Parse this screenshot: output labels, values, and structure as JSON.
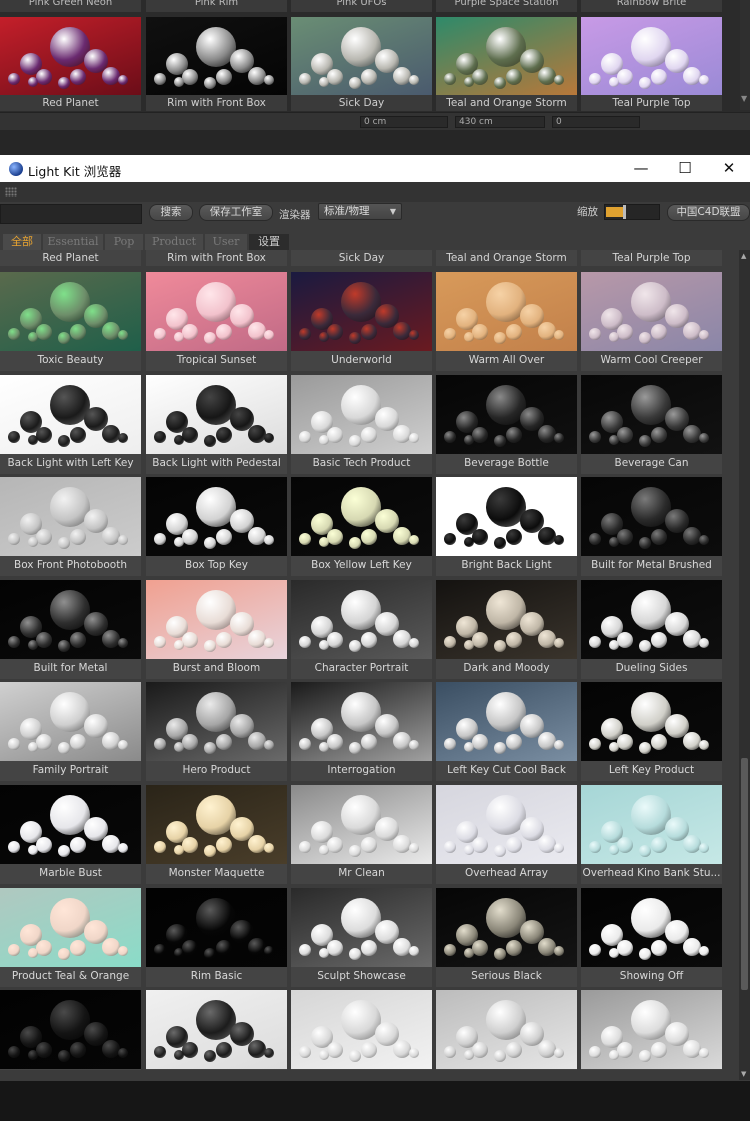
{
  "background_app": {
    "prev_row_labels": [
      "Pink Green Neon",
      "Pink Rim",
      "Pink UFOs",
      "Purple Space Station",
      "Rainbow Brite"
    ],
    "tiles": [
      {
        "label": "Red Planet",
        "bg": [
          "#c41f2a",
          "#6b0d18"
        ],
        "sphere": "#6a2a70"
      },
      {
        "label": "Rim with Front Box",
        "bg": [
          "#101010",
          "#040404"
        ],
        "sphere": "#8a8a8a"
      },
      {
        "label": "Sick Day",
        "bg": [
          "#6a8e74",
          "#4a5a6e"
        ],
        "sphere": "#b8b7b0"
      },
      {
        "label": "Teal and Orange Storm",
        "bg": [
          "#2e8a6a",
          "#b8783a"
        ],
        "sphere": "#5e6e4e"
      },
      {
        "label": "Teal Purple Top",
        "bg": [
          "#c89ae6",
          "#9a8ad6"
        ],
        "sphere": "#e0d6f0"
      }
    ],
    "fields": [
      "0 cm",
      "430 cm",
      "0"
    ]
  },
  "window": {
    "title": "Light Kit 浏览器",
    "controls": {
      "minimize": "—",
      "maximize": "☐",
      "close": "✕"
    }
  },
  "toolbar": {
    "search_value": "",
    "search_button": "搜索",
    "save_button": "保存工作室",
    "renderer_label": "渲染器",
    "renderer_value": "标准/物理",
    "zoom_label": "缩放",
    "zoom_value": 0.35,
    "union_button": "中国C4D联盟"
  },
  "tabs": [
    {
      "label": "全部",
      "active": true
    },
    {
      "label": "Essential",
      "active": false
    },
    {
      "label": "Pop",
      "active": false
    },
    {
      "label": "Product",
      "active": false
    },
    {
      "label": "User",
      "active": false
    },
    {
      "label": "设置",
      "active": false,
      "plain": true
    }
  ],
  "grid": {
    "header_row": [
      "Red Planet",
      "Rim with Front Box",
      "Sick Day",
      "Teal and Orange Storm",
      "Teal Purple Top"
    ],
    "items": [
      {
        "label": "Toxic Beauty",
        "bg": [
          "#5a6a4c",
          "#1f5f4a"
        ],
        "sphere": "#6e8e6a",
        "hl": "#7fe08a"
      },
      {
        "label": "Tropical Sunset",
        "bg": [
          "#f08a9a",
          "#c06a86"
        ],
        "sphere": "#f2c2cc",
        "hl": "#ffe6ea"
      },
      {
        "label": "Underworld",
        "bg": [
          "#1a1a40",
          "#6a1a20"
        ],
        "sphere": "#3a2a3a",
        "hl": "#c03a2a"
      },
      {
        "label": "Warm All Over",
        "bg": [
          "#d89a5a",
          "#c2804a"
        ],
        "sphere": "#e2b27e",
        "hl": "#f6d2a6"
      },
      {
        "label": "Warm Cool Creeper",
        "bg": [
          "#b898a8",
          "#8a86a8"
        ],
        "sphere": "#cdbcc8",
        "hl": "#f0e6ea"
      },
      {
        "label": "Back Light with Left Key",
        "bg": [
          "#ffffff",
          "#eeeeee"
        ],
        "sphere": "#1a1a1a",
        "hl": "#555555"
      },
      {
        "label": "Back Light with Pedestal",
        "bg": [
          "#ffffff",
          "#dcdcdc"
        ],
        "sphere": "#161616",
        "hl": "#444444"
      },
      {
        "label": "Basic Tech Product",
        "bg": [
          "#9a9a9a",
          "#cfcfcf"
        ],
        "sphere": "#d8d8d8",
        "hl": "#ffffff"
      },
      {
        "label": "Beverage Bottle",
        "bg": [
          "#060606",
          "#101010"
        ],
        "sphere": "#262626",
        "hl": "#8a8a8a"
      },
      {
        "label": "Beverage Can",
        "bg": [
          "#080808",
          "#121212"
        ],
        "sphere": "#3a3a3a",
        "hl": "#9a9a9a"
      },
      {
        "label": "Box Front Photobooth",
        "bg": [
          "#b6b6b6",
          "#cccccc"
        ],
        "sphere": "#c4c4c4",
        "hl": "#f2f2f2"
      },
      {
        "label": "Box Top Key",
        "bg": [
          "#040404",
          "#0a0a0a"
        ],
        "sphere": "#d2d2d2",
        "hl": "#ffffff"
      },
      {
        "label": "Box Yellow Left Key",
        "bg": [
          "#050505",
          "#0c0c0c"
        ],
        "sphere": "#d6d8b2",
        "hl": "#fbffd6"
      },
      {
        "label": "Bright Back Light",
        "bg": [
          "#ffffff",
          "#ffffff"
        ],
        "sphere": "#0c0c0c",
        "hl": "#3a3a3a"
      },
      {
        "label": "Built for Metal Brushed",
        "bg": [
          "#060606",
          "#0c0c0c"
        ],
        "sphere": "#2a2a2a",
        "hl": "#7a7a7a"
      },
      {
        "label": "Built for Metal",
        "bg": [
          "#030303",
          "#0a0a0a"
        ],
        "sphere": "#2e2e2e",
        "hl": "#909090"
      },
      {
        "label": "Burst and Bloom",
        "bg": [
          "#f0a090",
          "#e8d4dc"
        ],
        "sphere": "#e8dcd6",
        "hl": "#ffffff"
      },
      {
        "label": "Character Portrait",
        "bg": [
          "#2a2a2a",
          "#5a5a5a"
        ],
        "sphere": "#d4d4d4",
        "hl": "#ffffff"
      },
      {
        "label": "Dark and Moody",
        "bg": [
          "#141210",
          "#3a342c"
        ],
        "sphere": "#bfb6a6",
        "hl": "#efe6d6"
      },
      {
        "label": "Dueling Sides",
        "bg": [
          "#060606",
          "#0e0e0e"
        ],
        "sphere": "#d6d6d6",
        "hl": "#ffffff"
      },
      {
        "label": "Family Portrait",
        "bg": [
          "#d0d0d0",
          "#8a8a8a"
        ],
        "sphere": "#cfcfcf",
        "hl": "#ffffff"
      },
      {
        "label": "Hero Product",
        "bg": [
          "#1a1a1a",
          "#6a6a6a"
        ],
        "sphere": "#a6a6a6",
        "hl": "#eaeaea"
      },
      {
        "label": "Interrogation",
        "bg": [
          "#1a1a1a",
          "#a0a0a0"
        ],
        "sphere": "#c6c6c6",
        "hl": "#ffffff"
      },
      {
        "label": "Left Key Cut Cool Back",
        "bg": [
          "#3a4e62",
          "#7a8ea2"
        ],
        "sphere": "#c6c6c6",
        "hl": "#ffffff"
      },
      {
        "label": "Left Key Product",
        "bg": [
          "#040404",
          "#0a0a0a"
        ],
        "sphere": "#d0cfc8",
        "hl": "#ffffff"
      },
      {
        "label": "Marble Bust",
        "bg": [
          "#030303",
          "#080808"
        ],
        "sphere": "#e6e6ea",
        "hl": "#ffffff"
      },
      {
        "label": "Monster Maquette",
        "bg": [
          "#2a2418",
          "#4a3e2a"
        ],
        "sphere": "#e6d2a6",
        "hl": "#fff2d0"
      },
      {
        "label": "Mr Clean",
        "bg": [
          "#8a8a8a",
          "#eaeaea"
        ],
        "sphere": "#dadada",
        "hl": "#ffffff"
      },
      {
        "label": "Overhead Array",
        "bg": [
          "#d6d6de",
          "#eaeaf0"
        ],
        "sphere": "#dcdce4",
        "hl": "#ffffff"
      },
      {
        "label": "Overhead Kino Bank Stu...",
        "bg": [
          "#a6d6d6",
          "#c6e8e6"
        ],
        "sphere": "#b6dcdc",
        "hl": "#eafafa"
      },
      {
        "label": "Product Teal & Orange",
        "bg": [
          "#b0c8c0",
          "#8adcc8"
        ],
        "sphere": "#f0d6c8",
        "hl": "#ffe6d8"
      },
      {
        "label": "Rim Basic",
        "bg": [
          "#020202",
          "#050505"
        ],
        "sphere": "#060606",
        "hl": "#5a5a5a"
      },
      {
        "label": "Sculpt Showcase",
        "bg": [
          "#2a2a2a",
          "#6a6a6a"
        ],
        "sphere": "#dcdcdc",
        "hl": "#ffffff"
      },
      {
        "label": "Serious Black",
        "bg": [
          "#060606",
          "#141414"
        ],
        "sphere": "#8a8678",
        "hl": "#e2ddcc"
      },
      {
        "label": "Showing Off",
        "bg": [
          "#030303",
          "#0a0a0a"
        ],
        "sphere": "#eaeaea",
        "hl": "#ffffff"
      },
      {
        "label": "",
        "bg": [
          "#020202",
          "#060606"
        ],
        "sphere": "#141414",
        "hl": "#4a4a4a"
      },
      {
        "label": "",
        "bg": [
          "#f0f0f0",
          "#dcdcdc"
        ],
        "sphere": "#1c1c1c",
        "hl": "#6a6a6a"
      },
      {
        "label": "",
        "bg": [
          "#d6d6d6",
          "#f2f2f2"
        ],
        "sphere": "#d8d8d8",
        "hl": "#ffffff"
      },
      {
        "label": "",
        "bg": [
          "#bcbcbc",
          "#e6e6e6"
        ],
        "sphere": "#cfcfcf",
        "hl": "#ffffff"
      },
      {
        "label": "",
        "bg": [
          "#9a9a9a",
          "#dadada"
        ],
        "sphere": "#dcdcdc",
        "hl": "#ffffff"
      }
    ]
  }
}
